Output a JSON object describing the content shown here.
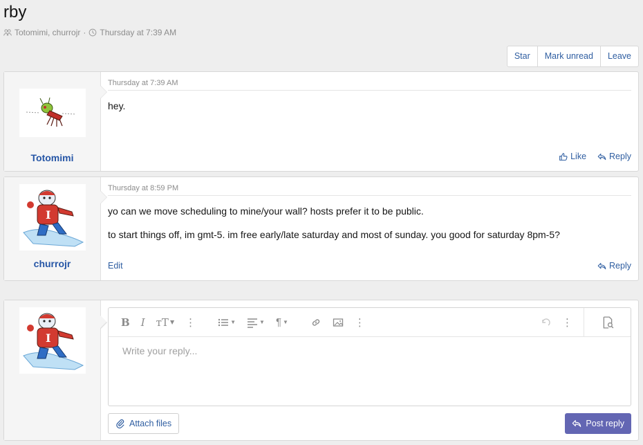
{
  "thread": {
    "title": "rby",
    "participants": "Totomimi, churrojr",
    "separator": "·",
    "date": "Thursday at 7:39 AM"
  },
  "actions": {
    "star": "Star",
    "mark_unread": "Mark unread",
    "leave": "Leave"
  },
  "messages": [
    {
      "username": "Totomimi",
      "date": "Thursday at 7:39 AM",
      "paragraphs": [
        "hey."
      ],
      "like": "Like",
      "reply": "Reply"
    },
    {
      "username": "churrojr",
      "date": "Thursday at 8:59 PM",
      "paragraphs": [
        "yo can we move scheduling to mine/your wall? hosts prefer it to be public.",
        "to start things off, im gmt-5. im free early/late saturday and most of sunday. you good for saturday 8pm-5?"
      ],
      "edit": "Edit",
      "reply": "Reply"
    }
  ],
  "reply_form": {
    "placeholder": "Write your reply...",
    "attach_label": "Attach files",
    "post_label": "Post reply"
  },
  "colors": {
    "accent": "#6366b3",
    "link": "#2f5ea1",
    "username": "#2656a6"
  }
}
